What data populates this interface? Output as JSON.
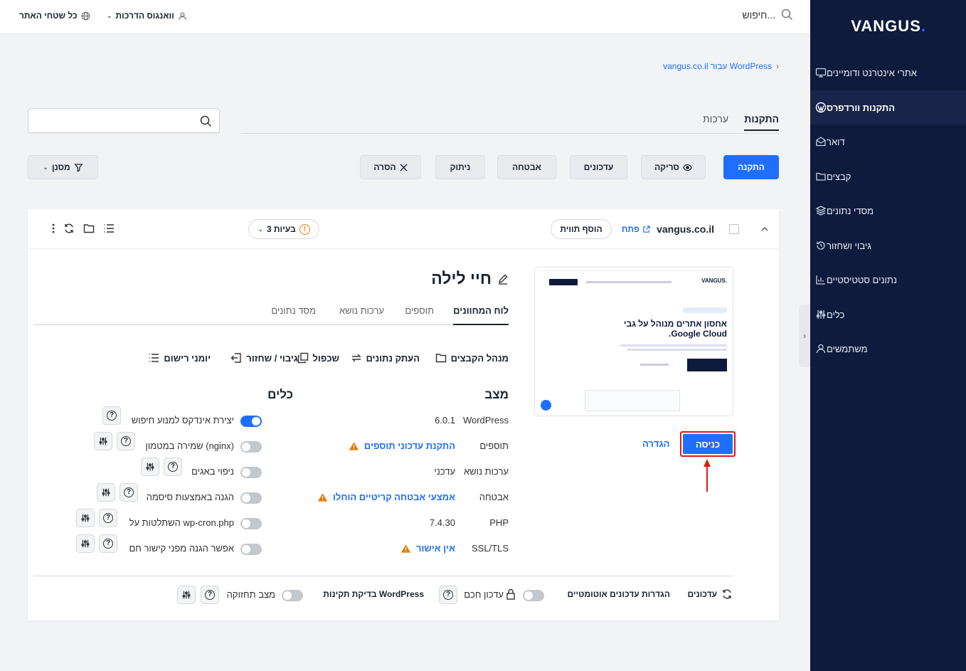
{
  "sidebar": {
    "brand": "VANGUS",
    "items": [
      {
        "label": "אתרי אינטרנט ודומיינים",
        "icon": "monitor-icon",
        "active": false
      },
      {
        "label": "התקנות וורדפרס",
        "icon": "wordpress-icon",
        "active": true
      },
      {
        "label": "דואר",
        "icon": "mail-icon",
        "active": false
      },
      {
        "label": "קבצים",
        "icon": "folder-icon",
        "active": false
      },
      {
        "label": "מסדי נתונים",
        "icon": "layers-icon",
        "active": false
      },
      {
        "label": "גיבוי ושחזור",
        "icon": "restore-icon",
        "active": false
      },
      {
        "label": "נתונים סטטיסטיים",
        "icon": "chart-icon",
        "active": false
      },
      {
        "label": "כלים",
        "icon": "sliders-icon",
        "active": false
      },
      {
        "label": "משתמשים",
        "icon": "user-icon",
        "active": false
      }
    ]
  },
  "topbar": {
    "search_placeholder": "חיפוש...",
    "user": "וואנגוס הדרכות",
    "scope": "כל שטחי האתר"
  },
  "breadcrumb": {
    "text": "WordPress עבור vangus.co.il"
  },
  "main_tabs": [
    "התקנות",
    "ערכות"
  ],
  "toolbar": {
    "install": "התקנה",
    "scan": "סריקה",
    "updates": "עדכונים",
    "security": "אבטחה",
    "detach": "ניתוק",
    "remove": "הסרה",
    "filter": "מסנן"
  },
  "site": {
    "domain": "vangus.co.il",
    "open": "פתח",
    "add_tag": "הוסף תווית",
    "issues": "3 בעיות",
    "title": "חיי לילה",
    "enter": "כניסה",
    "upgrade": "הגדרה",
    "preview": {
      "headline": "אחסון אתרים מנוהל על גבי Google Cloud.",
      "brand": "VANGUS."
    }
  },
  "inner_tabs": [
    "לוח המחוונים",
    "תוספים",
    "ערכות נושא",
    "מסד נתונים"
  ],
  "tools": [
    "מנהל הקבצים",
    "העתק נתונים",
    "שכפול",
    "גיבוי / שחזור",
    "יומני רישום"
  ],
  "status": {
    "title": "מצב",
    "rows": [
      {
        "label": "WordPress",
        "value": "6.0.1"
      },
      {
        "label": "תוספים",
        "value": "התקנת עדכוני תוספים"
      },
      {
        "label": "ערכות נושא",
        "value": "עדכני"
      },
      {
        "label": "אבטחה",
        "value": "אמצעי אבטחה קריטיים הוחלו"
      },
      {
        "label": "PHP",
        "value": "7.4.30"
      },
      {
        "label": "SSL/TLS",
        "value": "אין אישור"
      }
    ]
  },
  "tools_section": {
    "title": "כלים",
    "rows": [
      {
        "label": "יצירת אינדקס למנוע חיפוש",
        "on": true
      },
      {
        "label": "שמירה במטמון (nginx)",
        "on": false
      },
      {
        "label": "ניפוי באגים",
        "on": false
      },
      {
        "label": "הגנה באמצעות סיסמה",
        "on": false
      },
      {
        "label": "השתלטות על wp-cron.php",
        "on": false
      },
      {
        "label": "אפשר הגנה מפני קישור חם",
        "on": false
      }
    ]
  },
  "footer": {
    "updates": "עדכונים",
    "auto_updates": "הגדרות עדכונים אוטומטיים",
    "smart_update": "עדכון חכם",
    "integrity": "בדיקת תקינות WordPress",
    "maintenance": "מצב תחזוקה"
  },
  "colors": {
    "accent": "#1e6fff",
    "sidebar": "#0e1b3d",
    "warning": "#e07b00",
    "highlight": "#e01919"
  }
}
